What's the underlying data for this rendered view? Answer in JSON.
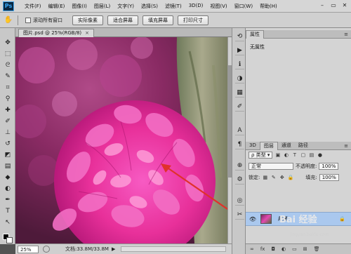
{
  "app": {
    "logo": "Ps"
  },
  "menus": [
    "文件(F)",
    "编辑(E)",
    "图像(I)",
    "图层(L)",
    "文字(Y)",
    "选择(S)",
    "滤镜(T)",
    "3D(D)",
    "视图(V)",
    "窗口(W)",
    "帮助(H)"
  ],
  "window_controls": {
    "minimize": "–",
    "restore": "▭",
    "close": "✕"
  },
  "options": {
    "tool_icon": "hand-icon",
    "scroll_all_label": "滚动所有窗口",
    "actual_pixels": "实际像素",
    "fit_screen": "适合屏幕",
    "fill_screen": "填充屏幕",
    "print_size": "打印尺寸"
  },
  "document": {
    "tab_title": "图片.psd @ 25%(RGB/8)",
    "close": "×"
  },
  "status": {
    "zoom": "25%",
    "doc_info": "文档:33.8M/33.8M",
    "arrow": "▶"
  },
  "properties": {
    "tab": "属性",
    "value": "无属性"
  },
  "layers": {
    "tabs": [
      "3D",
      "图层",
      "通道",
      "路径"
    ],
    "filter_type": "类型",
    "blend_mode": "正常",
    "opacity_label": "不透明度:",
    "opacity_value": "100%",
    "lock_label": "锁定:",
    "fill_label": "填充:",
    "fill_value": "100%",
    "layer_name": "背景",
    "footer_icons": [
      "link-icon",
      "fx-icon",
      "mask-icon",
      "adjustment-icon",
      "group-icon",
      "new-layer-icon",
      "trash-icon"
    ]
  },
  "watermark": {
    "text": "Bai 经验",
    "sub": "jingyan.baidu.com"
  },
  "colors": {
    "accent": "#aac8ee",
    "flower": "#e8309a",
    "annotation_arrow": "#e0312b"
  }
}
